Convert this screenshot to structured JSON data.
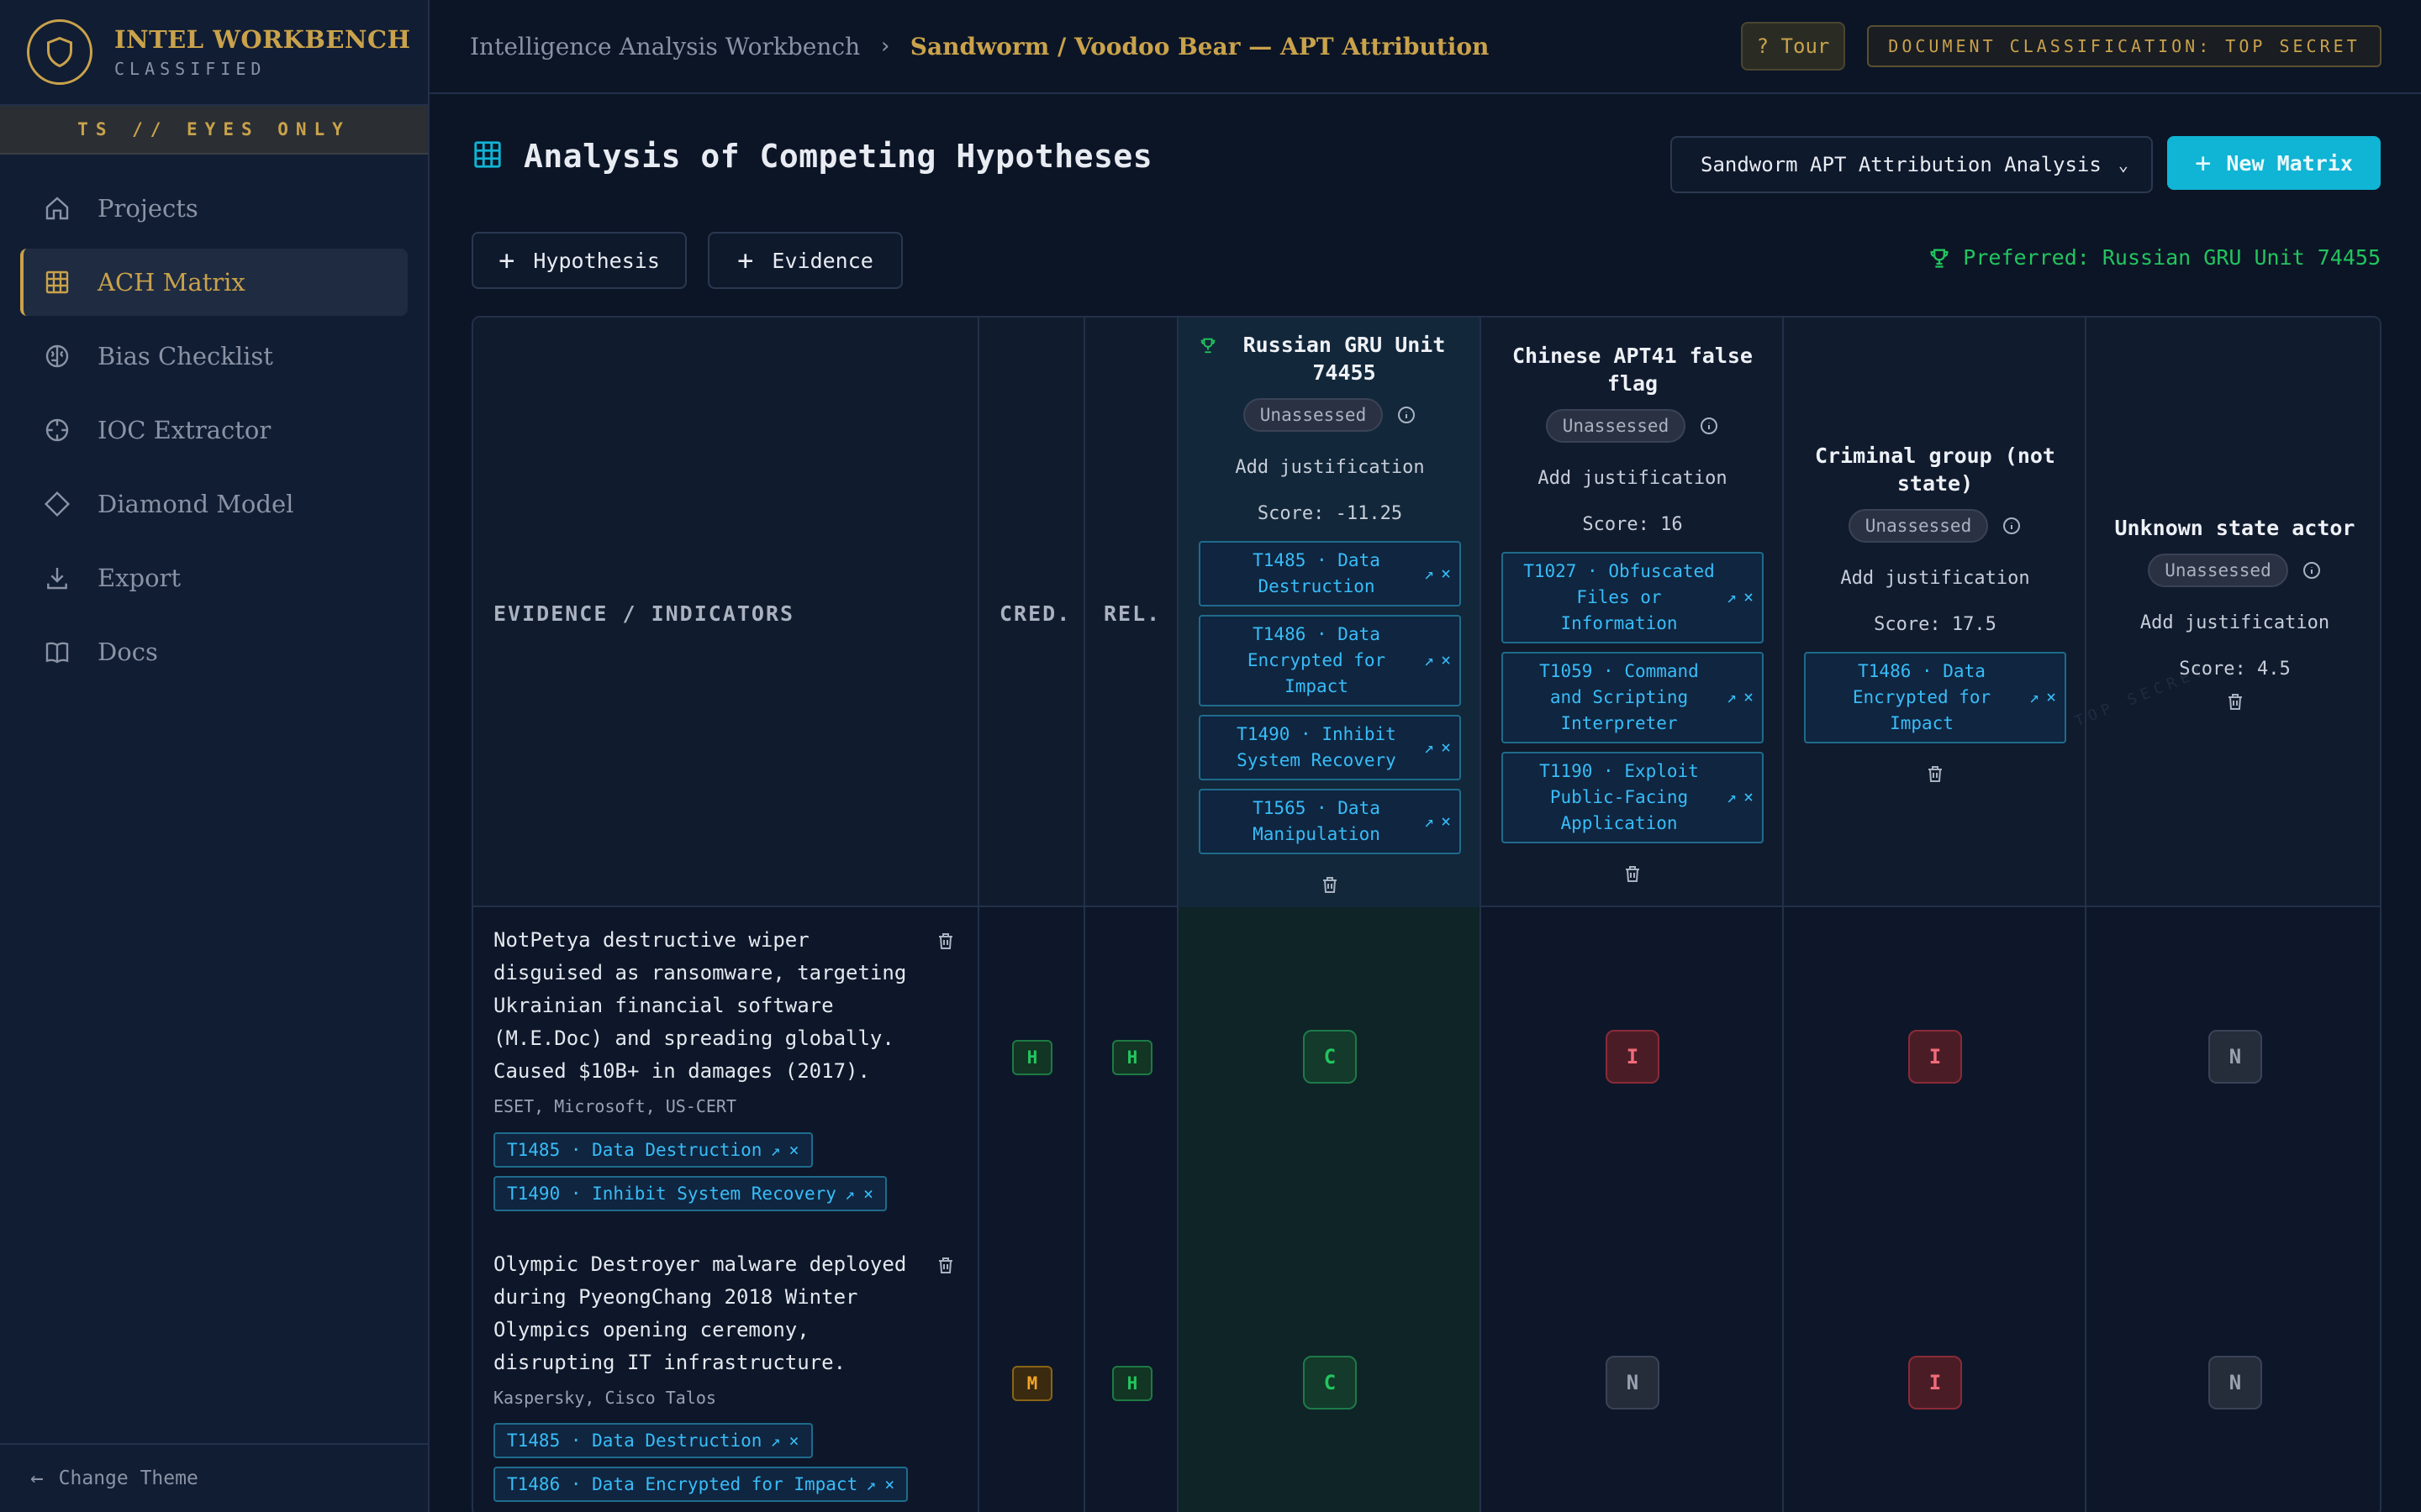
{
  "app": {
    "title": "INTEL WORKBENCH",
    "subtitle": "CLASSIFIED",
    "clearance": "TS // EYES ONLY"
  },
  "sidebar": {
    "items": [
      {
        "label": "Projects",
        "icon": "home-icon"
      },
      {
        "label": "ACH Matrix",
        "icon": "grid-icon",
        "active": true
      },
      {
        "label": "Bias Checklist",
        "icon": "brain-icon"
      },
      {
        "label": "IOC Extractor",
        "icon": "crosshair-icon"
      },
      {
        "label": "Diamond Model",
        "icon": "diamond-icon"
      },
      {
        "label": "Export",
        "icon": "download-icon"
      },
      {
        "label": "Docs",
        "icon": "book-icon"
      }
    ],
    "footer": "Change Theme"
  },
  "topbar": {
    "breadcrumb_root": "Intelligence Analysis Workbench",
    "breadcrumb_current": "Sandworm / Voodoo Bear — APT Attribution",
    "tour": "? Tour",
    "classification": "DOCUMENT CLASSIFICATION: TOP SECRET"
  },
  "main": {
    "title": "Analysis of Competing Hypotheses",
    "matrix_selector": "Sandworm APT Attribution Analysis",
    "new_matrix": "New Matrix",
    "add_hypothesis": "Hypothesis",
    "add_evidence": "Evidence",
    "preferred": "Preferred: Russian GRU Unit 74455"
  },
  "matrix": {
    "headers": {
      "evidence": "EVIDENCE / INDICATORS",
      "credibility": "CRED.",
      "relevance": "REL."
    },
    "watermark": "TOP SECRET",
    "hypotheses": [
      {
        "title": "Russian GRU Unit 74455",
        "status": "Unassessed",
        "justification": "Add justification",
        "score": "Score: -11.25",
        "preferred": true,
        "tags": [
          "T1485 · Data Destruction",
          "T1486 · Data Encrypted for Impact",
          "T1490 · Inhibit System Recovery",
          "T1565 · Data Manipulation"
        ]
      },
      {
        "title": "Chinese APT41 false flag",
        "status": "Unassessed",
        "justification": "Add justification",
        "score": "Score: 16",
        "tags": [
          "T1027 · Obfuscated Files or Information",
          "T1059 · Command and Scripting Interpreter",
          "T1190 · Exploit Public-Facing Application"
        ]
      },
      {
        "title": "Criminal group (not state)",
        "status": "Unassessed",
        "justification": "Add justification",
        "score": "Score: 17.5",
        "tags": [
          "T1486 · Data Encrypted for Impact"
        ]
      },
      {
        "title": "Unknown state actor",
        "status": "Unassessed",
        "justification": "Add justification",
        "score": "Score: 4.5",
        "tags": []
      }
    ],
    "evidence": [
      {
        "text": "NotPetya destructive wiper disguised as ransomware, targeting Ukrainian financial software (M.E.Doc) and spreading globally. Caused $10B+ in damages (2017).",
        "source": "ESET, Microsoft, US-CERT",
        "tags": [
          "T1485 · Data Destruction",
          "T1490 · Inhibit System Recovery"
        ],
        "credibility": "H",
        "relevance": "H",
        "ratings": [
          "C",
          "I",
          "I",
          "N"
        ]
      },
      {
        "text": "Olympic Destroyer malware deployed during PyeongChang 2018 Winter Olympics opening ceremony, disrupting IT infrastructure.",
        "source": "Kaspersky, Cisco Talos",
        "tags": [
          "T1485 · Data Destruction",
          "T1486 · Data Encrypted for Impact"
        ],
        "credibility": "M",
        "relevance": "H",
        "ratings": [
          "C",
          "N",
          "I",
          "N"
        ]
      }
    ]
  },
  "colors": {
    "gold": "#c9a24b",
    "cyan": "#10b4d4",
    "green": "#22c55e",
    "red": "#f26b7a",
    "amber": "#f5a524"
  }
}
